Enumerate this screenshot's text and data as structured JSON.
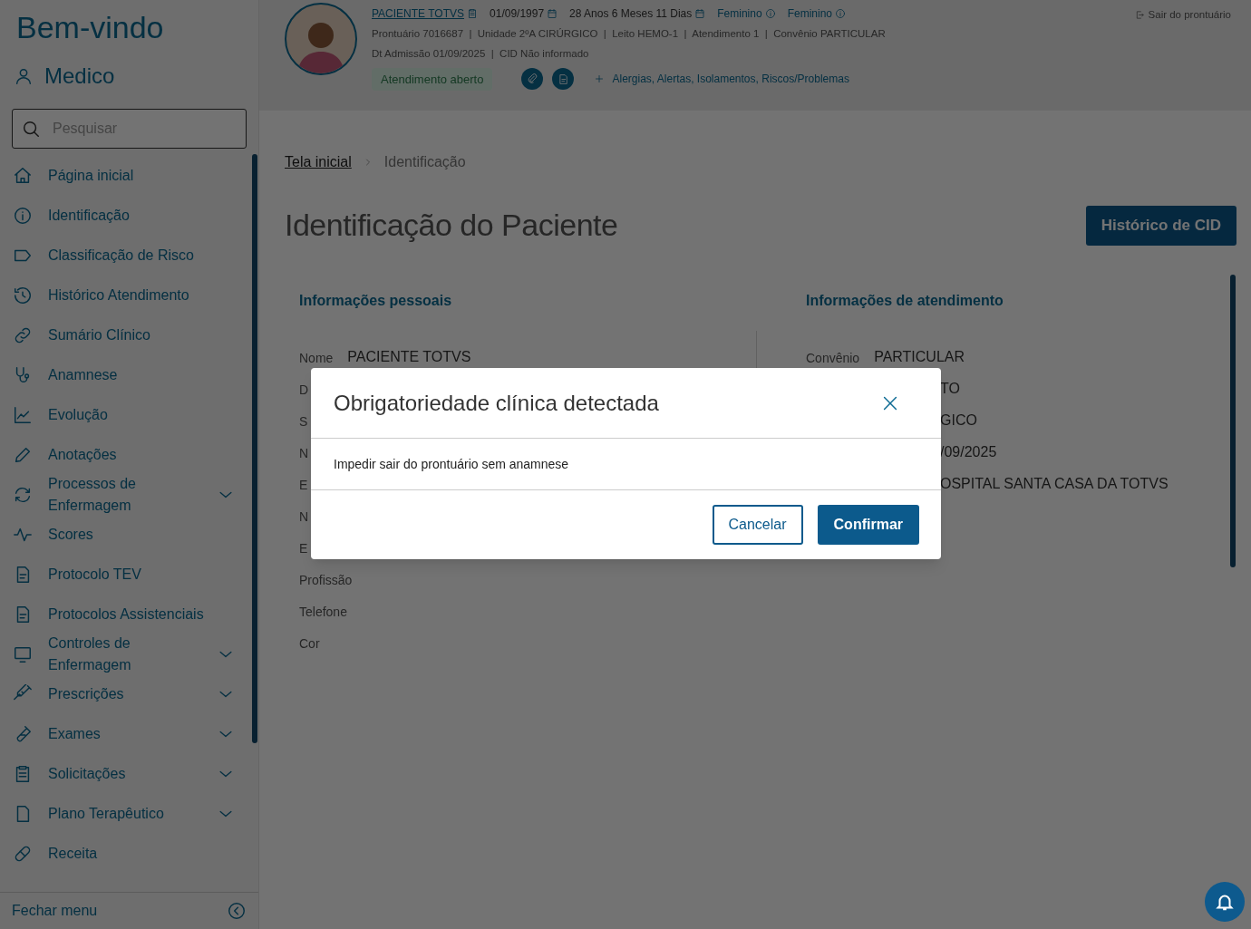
{
  "sidebar": {
    "title": "Bem-vindo",
    "user": "Medico",
    "search": {
      "placeholder": "Pesquisar"
    },
    "items": [
      {
        "label": "Página inicial",
        "expandable": false
      },
      {
        "label": "Identificação",
        "expandable": false
      },
      {
        "label": "Classificação de Risco",
        "expandable": false
      },
      {
        "label": "Histórico Atendimento",
        "expandable": false
      },
      {
        "label": "Sumário Clínico",
        "expandable": false
      },
      {
        "label": "Anamnese",
        "expandable": false
      },
      {
        "label": "Evolução",
        "expandable": false
      },
      {
        "label": "Anotações",
        "expandable": false
      },
      {
        "label": "Processos de Enfermagem",
        "expandable": true
      },
      {
        "label": "Scores",
        "expandable": false
      },
      {
        "label": "Protocolo TEV",
        "expandable": false
      },
      {
        "label": "Protocolos Assistenciais",
        "expandable": false
      },
      {
        "label": "Controles de Enfermagem",
        "expandable": true
      },
      {
        "label": "Prescrições",
        "expandable": true
      },
      {
        "label": "Exames",
        "expandable": true
      },
      {
        "label": "Solicitações",
        "expandable": true
      },
      {
        "label": "Plano Terapêutico",
        "expandable": true
      },
      {
        "label": "Receita",
        "expandable": false
      }
    ],
    "footer": "Fechar menu"
  },
  "header": {
    "patient_name": "PACIENTE TOTVS",
    "birth_date": "01/09/1997",
    "age": "28 Anos 6 Meses 11 Dias",
    "sex": "Feminino",
    "gender": "Feminino",
    "line_2": "Prontuário 7016687  |  Unidade 2ºA CIRÚRGICO  |  Leito HEMO-1  |  Atendimento 1  |  Convênio PARTICULAR",
    "line_3": "Dt Admissão 01/09/2025  |  CID Não informado",
    "status_badge": "Atendimento aberto",
    "alerts_link": "Alergias, Alertas, Isolamentos, Riscos/Problemas",
    "exit_link": "Sair do prontuário"
  },
  "breadcrumb": [
    {
      "label": "Tela inicial",
      "selected": false
    },
    {
      "label": "Identificação",
      "selected": true
    }
  ],
  "page_title": "Identificação do Paciente",
  "cid_history_button": "Histórico de CID",
  "personal_info": {
    "title": "Informações pessoais",
    "rows": [
      {
        "label": "Nome",
        "value": "PACIENTE TOTVS"
      },
      {
        "label": "D"
      },
      {
        "label": "S"
      },
      {
        "label": "N"
      },
      {
        "label": "E"
      },
      {
        "label": "N"
      },
      {
        "label": "E"
      },
      {
        "label": "Profissão"
      },
      {
        "label": "Telefone"
      },
      {
        "label": "Cor"
      }
    ]
  },
  "care_info": {
    "title": "Informações de atendimento",
    "rows": [
      {
        "label": "Convênio",
        "value": "PARTICULAR"
      },
      {
        "value": "TO"
      },
      {
        "value": "GICO"
      },
      {
        "value": "/09/2025"
      },
      {
        "value": "OSPITAL SANTA CASA DA TOTVS"
      }
    ]
  },
  "dialog": {
    "title": "Obrigatoriedade clínica detectada",
    "message": "Impedir sair do prontuário sem anamnese",
    "buttons": [
      {
        "label": "Cancelar",
        "kind": "secondary"
      },
      {
        "label": "Confirmar",
        "kind": "primary"
      }
    ]
  }
}
